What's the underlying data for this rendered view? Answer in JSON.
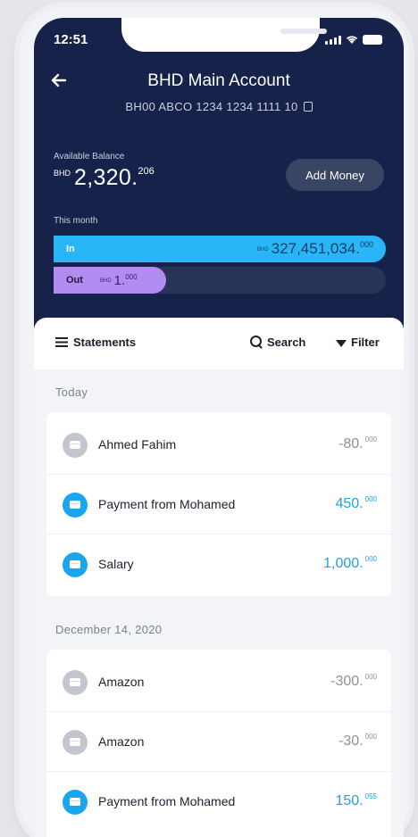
{
  "status_bar": {
    "time": "12:51"
  },
  "header": {
    "title": "BHD Main Account",
    "account_number": "BH00 ABCO 1234 1234 1111 10",
    "available_label": "Available Balance",
    "currency": "BHD",
    "balance_main": "2,320.",
    "balance_decimals": "206",
    "add_money_label": "Add Money",
    "month_label": "This month"
  },
  "cash_flow": {
    "in": {
      "label": "In",
      "currency": "BHD",
      "amount_main": "327,451,034.",
      "amount_decimals": "000",
      "fill_fraction": 1.0
    },
    "out": {
      "label": "Out",
      "currency": "BHD",
      "amount_main": "1.",
      "amount_decimals": "000",
      "fill_fraction": 0.34
    }
  },
  "toolbar": {
    "statements_label": "Statements",
    "search_label": "Search",
    "filter_label": "Filter"
  },
  "sections": [
    {
      "label": "Today",
      "transactions": [
        {
          "name": "Ahmed Fahim",
          "amount_main": "-80.",
          "amount_decimals": "000",
          "type": "debit"
        },
        {
          "name": "Payment from Mohamed",
          "amount_main": "450.",
          "amount_decimals": "000",
          "type": "credit"
        },
        {
          "name": "Salary",
          "amount_main": "1,000.",
          "amount_decimals": "000",
          "type": "credit"
        }
      ]
    },
    {
      "label": "December 14, 2020",
      "transactions": [
        {
          "name": "Amazon",
          "amount_main": "-300.",
          "amount_decimals": "000",
          "type": "debit"
        },
        {
          "name": "Amazon",
          "amount_main": "-30.",
          "amount_decimals": "000",
          "type": "debit"
        },
        {
          "name": "Payment from Mohamed",
          "amount_main": "150.",
          "amount_decimals": "055",
          "type": "credit"
        }
      ]
    }
  ],
  "colors": {
    "header_bg": "#16224a",
    "in_bar": "#28b6f6",
    "out_bar": "#b28cf0",
    "credit": "#1ea3de",
    "debit": "#8d919c"
  }
}
